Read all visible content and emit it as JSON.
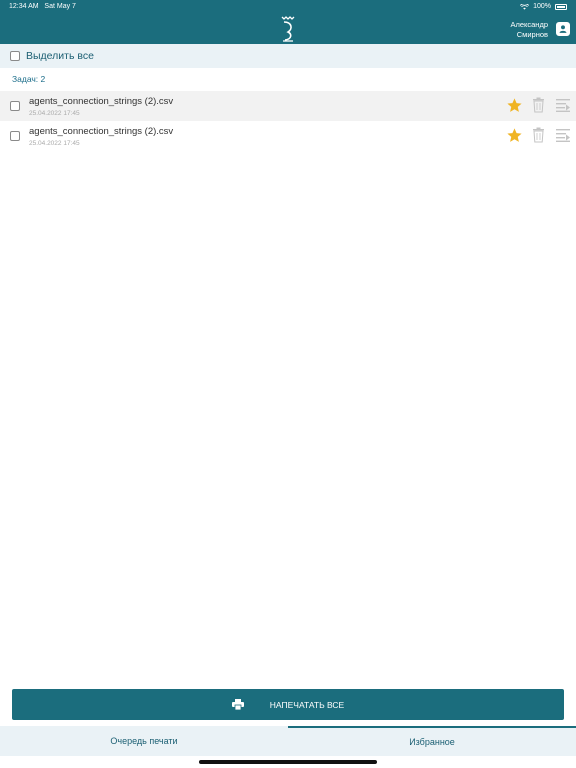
{
  "status": {
    "time": "12:34 AM",
    "date": "Sat May 7",
    "battery": "100%"
  },
  "header": {
    "user_first": "Александр",
    "user_last": "Смирнов"
  },
  "select_all": {
    "label": "Выделить все"
  },
  "tasks": {
    "count_label": "Задач: 2"
  },
  "files": [
    {
      "name": "agents_connection_strings (2).csv",
      "date": "25.04.2022 17:45",
      "favorite": true
    },
    {
      "name": "agents_connection_strings (2).csv",
      "date": "25.04.2022 17:45",
      "favorite": true
    }
  ],
  "print_all": {
    "label": "НАПЕЧАТАТЬ ВСЕ"
  },
  "tabs": [
    {
      "label": "Очередь печати",
      "active": false
    },
    {
      "label": "Избранное",
      "active": true
    }
  ],
  "colors": {
    "primary": "#1b6d7d",
    "star": "#f0b423",
    "bar_bg": "#eaf2f6"
  }
}
